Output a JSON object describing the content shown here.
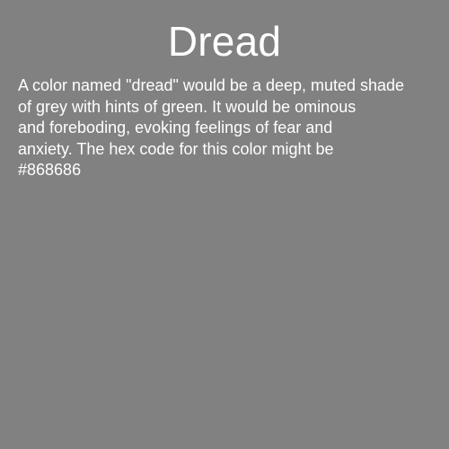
{
  "card": {
    "title": "Dread",
    "description_lines": [
      "A color named \"dread\" would be a deep, muted shade",
      "of grey with hints of green. It would be ominous",
      "and foreboding, evoking feelings of fear and",
      "anxiety. The hex code for this color might be",
      "#868686"
    ],
    "background_color": "#818181",
    "text_color": "#ffffff"
  }
}
